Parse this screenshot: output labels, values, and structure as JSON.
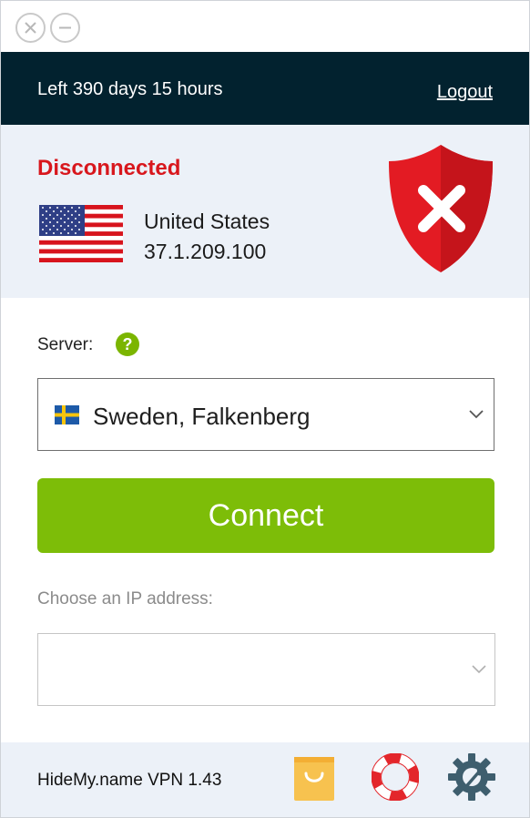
{
  "window": {
    "close_icon": "close-icon",
    "minimize_icon": "minimize-icon"
  },
  "header": {
    "days_left": "Left 390 days 15 hours",
    "logout": "Logout"
  },
  "status": {
    "text": "Disconnected",
    "country": "United States",
    "ip": "37.1.209.100",
    "flag_icon": "us-flag-icon",
    "shield_icon": "shield-x-icon",
    "color": "#d8171d"
  },
  "server": {
    "label": "Server:",
    "help": "?",
    "selected": "Sweden, Falkenberg",
    "flag_icon": "sweden-flag-icon"
  },
  "connect": {
    "label": "Connect",
    "color": "#7dbd08"
  },
  "ip_choice": {
    "label": "Choose an IP address:",
    "selected": ""
  },
  "footer": {
    "version": "HideMy.name VPN 1.43",
    "icons": [
      "shopping-bag-icon",
      "lifebuoy-icon",
      "settings-wrench-icon"
    ]
  },
  "colors": {
    "header_bg": "#02222f",
    "panel_bg": "#ecf1f8",
    "accent_green": "#7dbd08"
  }
}
